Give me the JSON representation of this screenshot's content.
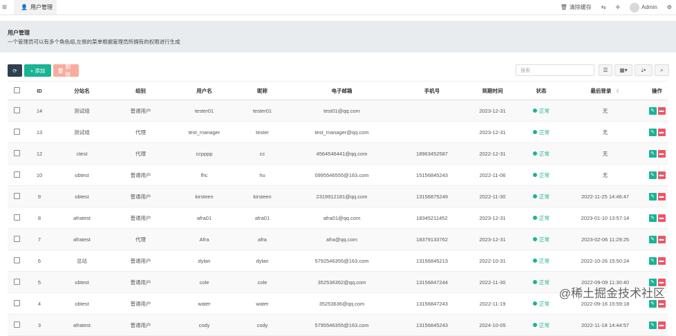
{
  "topbar": {
    "menu_icon": "menu-icon",
    "tab_label": "用户管理",
    "clear_cache": "清除缓存",
    "username": "Admin"
  },
  "header": {
    "title": "用户管理",
    "description": "一个管理员可以有多个角色组,左侧的菜单根据管理员所拥有的权限进行生成"
  },
  "toolbar": {
    "add_label": "添加",
    "delete_label": "删除",
    "search_placeholder": "搜索"
  },
  "table": {
    "columns": [
      "ID",
      "分站名",
      "组别",
      "用户名",
      "昵称",
      "电子邮箱",
      "手机号",
      "到期时间",
      "状态",
      "最后登录",
      "操作"
    ],
    "rows": [
      {
        "id": "14",
        "site": "测试组",
        "group": "普通用户",
        "username": "tester01",
        "nick": "tester01",
        "email": "test01@qq.com",
        "phone": "",
        "expire": "2023-12-31",
        "status": "正常",
        "last": "无"
      },
      {
        "id": "13",
        "site": "测试组",
        "group": "代理",
        "username": "test_manager",
        "nick": "tester",
        "email": "test_manager@qq.com",
        "phone": "",
        "expire": "2023-12-31",
        "status": "正常",
        "last": "无"
      },
      {
        "id": "12",
        "site": "ctest",
        "group": "代理",
        "username": "ccpppp",
        "nick": "cc",
        "email": "4564546441@qq.com",
        "phone": "18963452587",
        "expire": "2022-12-31",
        "status": "正常",
        "last": "无"
      },
      {
        "id": "10",
        "site": "obtest",
        "group": "普通用户",
        "username": "fhc",
        "nick": "hu",
        "email": "0995546555@163.com",
        "phone": "15156845243",
        "expire": "2022-11-06",
        "status": "正常",
        "last": "无"
      },
      {
        "id": "9",
        "site": "obtest",
        "group": "普通用户",
        "username": "kirsteen",
        "nick": "kirsteen",
        "email": "2319912181@qq.com",
        "phone": "13156875249",
        "expire": "2022-11-30",
        "status": "正常",
        "last": "2022-11-25 14:46:47"
      },
      {
        "id": "8",
        "site": "afratest",
        "group": "普通用户",
        "username": "afra01",
        "nick": "afra01",
        "email": "afra01@qq.com",
        "phone": "18345211452",
        "expire": "2023-12-31",
        "status": "正常",
        "last": "2023-01-10 13:57:14"
      },
      {
        "id": "7",
        "site": "afratest",
        "group": "代理",
        "username": "Afra",
        "nick": "afra",
        "email": "afra@qq.com",
        "phone": "18379133762",
        "expire": "2023-12-31",
        "status": "正常",
        "last": "2023-02-06 11:29:25"
      },
      {
        "id": "6",
        "site": "总站",
        "group": "普通用户",
        "username": "dylan",
        "nick": "dylan",
        "email": "5792546355@163.com",
        "phone": "13156845213",
        "expire": "2022-10-31",
        "status": "正常",
        "last": "2022-10-26 15:50:24"
      },
      {
        "id": "5",
        "site": "obtest",
        "group": "普通用户",
        "username": "cole",
        "nick": "cole",
        "email": "352536362@qq.com",
        "phone": "13156847244",
        "expire": "2022-11-30",
        "status": "正常",
        "last": "2022-09-09 11:30:40"
      },
      {
        "id": "4",
        "site": "obtest",
        "group": "普通用户",
        "username": "water",
        "nick": "water",
        "email": "35253636@qq.com",
        "phone": "13156847243",
        "expire": "2022-11-19",
        "status": "正常",
        "last": "2022-09-16 15:59:18"
      },
      {
        "id": "3",
        "site": "afratest",
        "group": "普通用户",
        "username": "cody",
        "nick": "cody",
        "email": "5795546355@163.com",
        "phone": "13156845243",
        "expire": "2024-10-05",
        "status": "正常",
        "last": "2022-11-18 14:44:57"
      }
    ]
  },
  "watermark": "@稀土掘金技术社区",
  "colors": {
    "primary": "#1ab394",
    "danger": "#ed5565",
    "dark": "#2f4050",
    "delete_disabled": "#f8ac9e"
  }
}
